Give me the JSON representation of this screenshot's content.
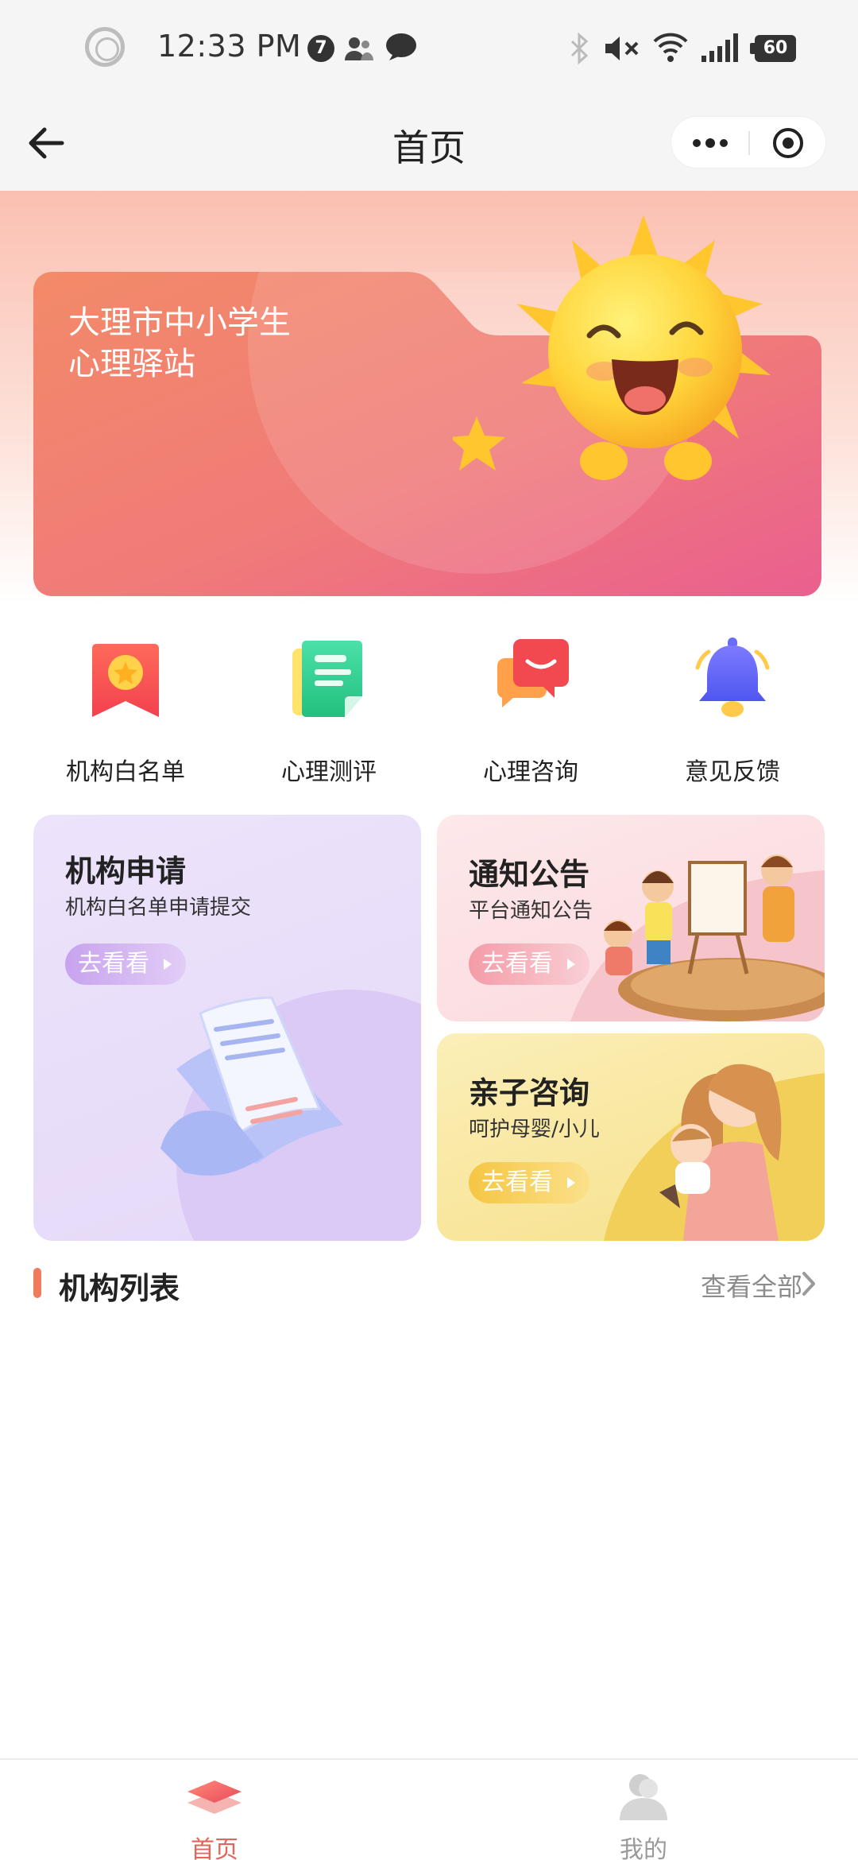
{
  "status_bar": {
    "time": "12:33 PM",
    "notification_count": "7",
    "battery": "60"
  },
  "nav": {
    "title": "首页"
  },
  "banner": {
    "title_line1": "大理市中小学生",
    "title_line2": "心理驿站"
  },
  "quick_actions": [
    {
      "label": "机构白名单",
      "icon": "bookmark-star-icon"
    },
    {
      "label": "心理测评",
      "icon": "document-icon"
    },
    {
      "label": "心理咨询",
      "icon": "chat-bubble-icon"
    },
    {
      "label": "意见反馈",
      "icon": "bell-icon"
    }
  ],
  "cards": {
    "apply": {
      "title": "机构申请",
      "subtitle": "机构白名单申请提交",
      "button": "去看看"
    },
    "notice": {
      "title": "通知公告",
      "subtitle": "平台通知公告",
      "button": "去看看"
    },
    "parent": {
      "title": "亲子咨询",
      "subtitle": "呵护母婴/小儿",
      "button": "去看看"
    }
  },
  "section": {
    "title": "机构列表",
    "more": "查看全部"
  },
  "tabs": [
    {
      "label": "首页",
      "active": true
    },
    {
      "label": "我的",
      "active": false
    }
  ],
  "colors": {
    "accent": "#f07b5d",
    "tab_active": "#e0655a",
    "tab_inactive": "#9a9a9a"
  }
}
